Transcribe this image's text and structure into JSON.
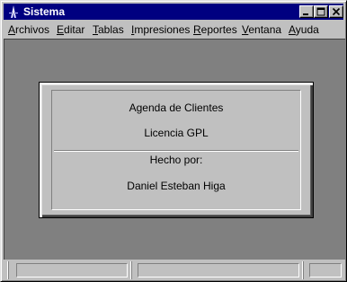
{
  "window": {
    "title": "Sistema",
    "title_bar_color": "#000080"
  },
  "icons": {
    "app": "app-logo-icon",
    "minimize": "minimize-icon",
    "maximize": "maximize-icon",
    "close": "close-icon"
  },
  "menu": [
    "Archivos",
    "Editar",
    "Tablas",
    "Impresiones",
    "Reportes",
    "Ventana",
    "Ayuda"
  ],
  "about": {
    "app_name": "Agenda de Clientes",
    "license": "Licencia GPL",
    "made_by_label": "Hecho por:",
    "author": "Daniel Esteban Higa"
  },
  "colors": {
    "workspace": "#808080",
    "face": "#c0c0c0"
  }
}
